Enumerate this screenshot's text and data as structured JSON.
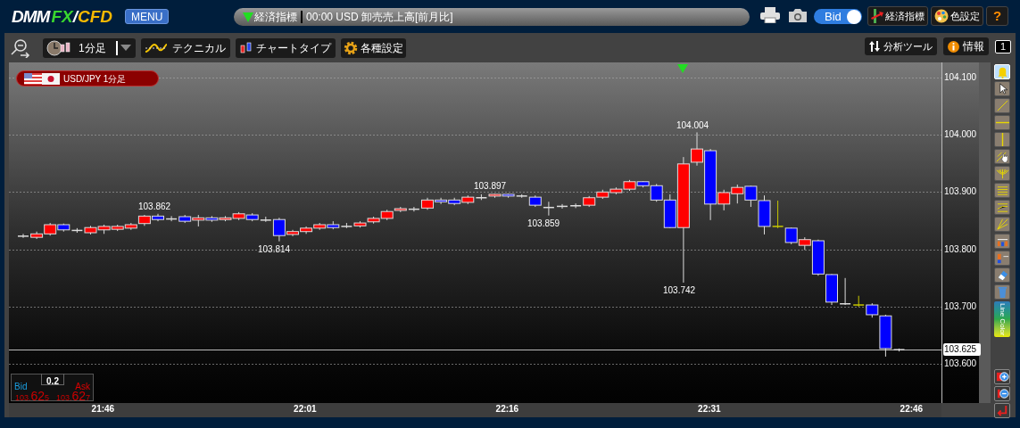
{
  "header": {
    "logo": {
      "dmm": "DMM",
      "fx": "FX",
      "slash": "/",
      "cfd": "CFD"
    },
    "menu_button": "MENU",
    "ticker": {
      "label": "経済指標",
      "text": "00:00 USD 卸売売上高[前月比]"
    },
    "bid_toggle": {
      "label": "Bid",
      "on": true
    },
    "buttons": [
      "経済指標",
      "色設定",
      "?"
    ]
  },
  "toolbar": {
    "timeframe": "1分足",
    "buttons": [
      "テクニカル",
      "チャートタイプ",
      "各種設定"
    ],
    "right_buttons": [
      "分析ツール",
      "情報"
    ],
    "page_badge": "1"
  },
  "chart": {
    "symbol": "USD/JPY 1分足",
    "price_labels": [
      "103.862",
      "103.814",
      "103.897",
      "103.859",
      "104.004",
      "103.742"
    ],
    "quote": {
      "bid_label": "Bid",
      "spread": "0.2",
      "ask_label": "Ask",
      "bid": "103.625",
      "ask": "103.627"
    },
    "chart_data": {
      "type": "candlestick",
      "categories": [
        null,
        null,
        null,
        null,
        null,
        null,
        "21:46",
        null,
        null,
        null,
        null,
        null,
        null,
        null,
        null,
        null,
        null,
        null,
        null,
        null,
        null,
        "22:01",
        null,
        null,
        null,
        null,
        null,
        null,
        null,
        null,
        null,
        null,
        null,
        null,
        null,
        null,
        "22:16",
        null,
        null,
        null,
        null,
        null,
        null,
        null,
        null,
        null,
        null,
        null,
        null,
        null,
        null,
        "22:31",
        null,
        null,
        null,
        null,
        null,
        null,
        null,
        null,
        null,
        null,
        null,
        null,
        null,
        null,
        "22:46"
      ],
      "ohlc": [
        [
          103.824,
          103.827,
          103.82,
          103.823
        ],
        [
          103.821,
          103.831,
          103.818,
          103.827
        ],
        [
          103.827,
          103.846,
          103.824,
          103.843
        ],
        [
          103.843,
          103.845,
          103.831,
          103.834
        ],
        [
          103.834,
          103.837,
          103.829,
          103.833
        ],
        [
          103.829,
          103.841,
          103.826,
          103.838
        ],
        [
          103.834,
          103.843,
          103.827,
          103.84
        ],
        [
          103.835,
          103.843,
          103.832,
          103.84
        ],
        [
          103.837,
          103.846,
          103.834,
          103.843
        ],
        [
          103.845,
          103.86,
          103.841,
          103.858
        ],
        [
          103.858,
          103.862,
          103.849,
          103.852
        ],
        [
          103.854,
          103.858,
          103.849,
          103.853
        ],
        [
          103.857,
          103.86,
          103.846,
          103.849
        ],
        [
          103.851,
          103.86,
          103.84,
          103.855
        ],
        [
          103.855,
          103.858,
          103.848,
          103.851
        ],
        [
          103.852,
          103.858,
          103.849,
          103.855
        ],
        [
          103.854,
          103.865,
          103.851,
          103.862
        ],
        [
          103.86,
          103.863,
          103.849,
          103.852
        ],
        [
          103.852,
          103.857,
          103.848,
          103.851
        ],
        [
          103.852,
          103.855,
          103.814,
          103.824
        ],
        [
          103.826,
          103.834,
          103.823,
          103.831
        ],
        [
          103.831,
          103.84,
          103.827,
          103.837
        ],
        [
          103.837,
          103.846,
          103.834,
          103.843
        ],
        [
          103.843,
          103.849,
          103.835,
          103.838
        ],
        [
          103.841,
          103.846,
          103.837,
          103.84
        ],
        [
          103.841,
          103.849,
          103.838,
          103.846
        ],
        [
          103.848,
          103.857,
          103.845,
          103.854
        ],
        [
          103.854,
          103.869,
          103.851,
          103.866
        ],
        [
          103.868,
          103.874,
          103.865,
          103.871
        ],
        [
          103.871,
          103.874,
          103.866,
          103.87
        ],
        [
          103.872,
          103.89,
          103.869,
          103.886
        ],
        [
          103.886,
          103.89,
          103.879,
          103.883
        ],
        [
          103.886,
          103.89,
          103.877,
          103.88
        ],
        [
          103.882,
          103.894,
          103.879,
          103.891
        ],
        [
          103.891,
          103.896,
          103.886,
          103.89
        ],
        [
          103.893,
          103.897,
          103.89,
          103.896
        ],
        [
          103.896,
          103.897,
          103.89,
          103.893
        ],
        [
          103.894,
          103.896,
          103.89,
          103.893
        ],
        [
          103.891,
          103.894,
          103.874,
          103.877
        ],
        [
          103.874,
          103.883,
          103.859,
          103.873
        ],
        [
          103.876,
          103.879,
          103.871,
          103.875
        ],
        [
          103.877,
          103.88,
          103.872,
          103.876
        ],
        [
          103.877,
          103.893,
          103.874,
          103.89
        ],
        [
          103.891,
          103.904,
          103.888,
          103.9
        ],
        [
          103.899,
          103.908,
          103.896,
          103.905
        ],
        [
          103.905,
          103.921,
          103.902,
          103.918
        ],
        [
          103.918,
          103.919,
          103.908,
          103.911
        ],
        [
          103.911,
          103.914,
          103.883,
          103.886
        ],
        [
          103.886,
          103.896,
          103.837,
          103.838
        ],
        [
          103.838,
          103.961,
          103.742,
          103.949
        ],
        [
          103.952,
          104.004,
          103.946,
          103.975
        ],
        [
          103.972,
          103.975,
          103.851,
          103.879
        ],
        [
          103.879,
          103.904,
          103.868,
          103.899
        ],
        [
          103.897,
          103.913,
          103.88,
          103.908
        ],
        [
          103.91,
          103.911,
          103.874,
          103.886
        ],
        [
          103.885,
          103.894,
          103.826,
          103.84
        ],
        [
          103.84,
          103.885,
          103.837,
          103.84
        ],
        [
          103.837,
          103.838,
          103.809,
          103.812
        ],
        [
          103.807,
          103.821,
          103.799,
          103.817
        ],
        [
          103.815,
          103.817,
          103.754,
          103.757
        ],
        [
          103.756,
          103.757,
          103.703,
          103.708
        ],
        [
          103.706,
          103.75,
          103.703,
          103.705
        ],
        [
          103.703,
          103.719,
          103.7,
          103.703
        ],
        [
          103.703,
          103.706,
          103.681,
          103.686
        ],
        [
          103.684,
          103.686,
          103.613,
          103.627
        ],
        [
          103.626,
          103.627,
          103.622,
          103.625
        ],
        null
      ],
      "ylim": [
        103.532,
        104.126
      ],
      "grid": true,
      "ref_lines": [
        {
          "axis": "y",
          "value": 103.625,
          "label": "103.625"
        }
      ],
      "yticks": [
        {
          "value": 104.1,
          "label": "104.100"
        },
        {
          "value": 104.0,
          "label": "104.000"
        },
        {
          "value": 103.9,
          "label": "103.900"
        },
        {
          "value": 103.8,
          "label": "103.800"
        },
        {
          "value": 103.7,
          "label": "103.700"
        },
        {
          "value": 103.6,
          "label": "103.600"
        }
      ]
    }
  },
  "tools": [
    {
      "kind": "bell",
      "selected": true
    },
    {
      "kind": "cursor",
      "selected": false
    },
    {
      "kind": "diagonal",
      "selected": false
    },
    {
      "kind": "horizontal",
      "selected": false
    },
    {
      "kind": "vertical",
      "selected": false
    },
    {
      "kind": "hand",
      "selected": false
    },
    {
      "kind": "fan",
      "selected": false
    },
    {
      "kind": "parallel",
      "selected": false
    },
    {
      "kind": "channel",
      "selected": false
    },
    {
      "kind": "rays",
      "selected": false
    },
    {
      "kind": "candles",
      "selected": false
    },
    {
      "kind": "candle",
      "selected": false
    },
    {
      "kind": "eraser",
      "selected": false
    },
    {
      "kind": "trash",
      "selected": false
    },
    {
      "kind": "color",
      "label": "Line Color",
      "selected": false
    }
  ],
  "zoom_tools": [
    {
      "kind": "zoom_in"
    },
    {
      "kind": "zoom_out"
    },
    {
      "kind": "return"
    }
  ]
}
